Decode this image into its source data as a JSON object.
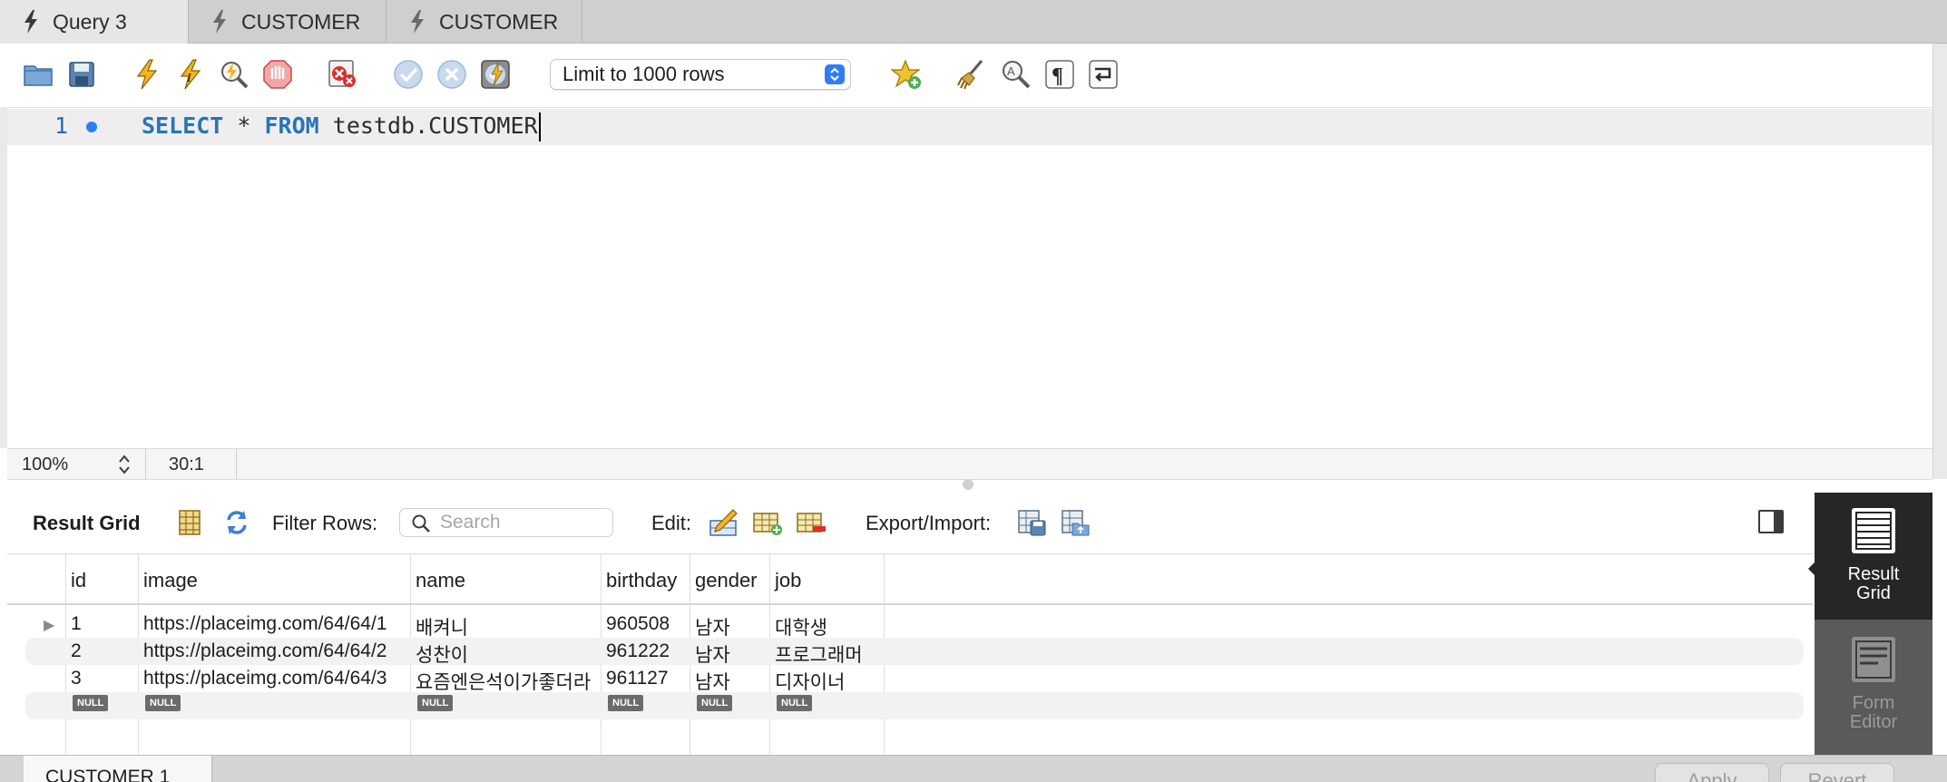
{
  "tabs": [
    {
      "label": "Query 3",
      "active": true
    },
    {
      "label": "CUSTOMER",
      "active": false
    },
    {
      "label": "CUSTOMER",
      "active": false
    }
  ],
  "toolbar": {
    "icons": [
      "open-file-icon",
      "save-icon",
      "execute-icon",
      "execute-current-icon",
      "explain-icon",
      "stop-icon",
      "toggle-error-icon",
      "commit-icon",
      "rollback-icon",
      "autocommit-icon",
      "add-snippet-icon",
      "beautify-icon",
      "find-icon",
      "invisible-chars-icon",
      "wrap-icon"
    ],
    "limit_select": "Limit to 1000 rows"
  },
  "editor": {
    "line_number": "1",
    "kw_select": "SELECT",
    "star": "*",
    "kw_from": "FROM",
    "table": "testdb.CUSTOMER"
  },
  "status": {
    "zoom": "100%",
    "cursor": "30:1"
  },
  "result_toolbar": {
    "title": "Result Grid",
    "filter_label": "Filter Rows:",
    "search_placeholder": "Search",
    "edit_label": "Edit:",
    "export_label": "Export/Import:"
  },
  "grid": {
    "columns": [
      "id",
      "image",
      "name",
      "birthday",
      "gender",
      "job"
    ],
    "rows": [
      {
        "id": "1",
        "image": "https://placeimg.com/64/64/1",
        "name": "배켜니",
        "birthday": "960508",
        "gender": "남자",
        "job": "대학생"
      },
      {
        "id": "2",
        "image": "https://placeimg.com/64/64/2",
        "name": "성찬이",
        "birthday": "961222",
        "gender": "남자",
        "job": "프로그래머"
      },
      {
        "id": "3",
        "image": "https://placeimg.com/64/64/3",
        "name": "요즘엔은석이가좋더라",
        "birthday": "961127",
        "gender": "남자",
        "job": "디자이너"
      }
    ],
    "null_label": "NULL"
  },
  "side_panel": {
    "result_grid_1": "Result",
    "result_grid_2": "Grid",
    "form_editor_1": "Form",
    "form_editor_2": "Editor"
  },
  "bottom": {
    "result_tab": "CUSTOMER 1",
    "apply": "Apply",
    "revert": "Revert"
  }
}
